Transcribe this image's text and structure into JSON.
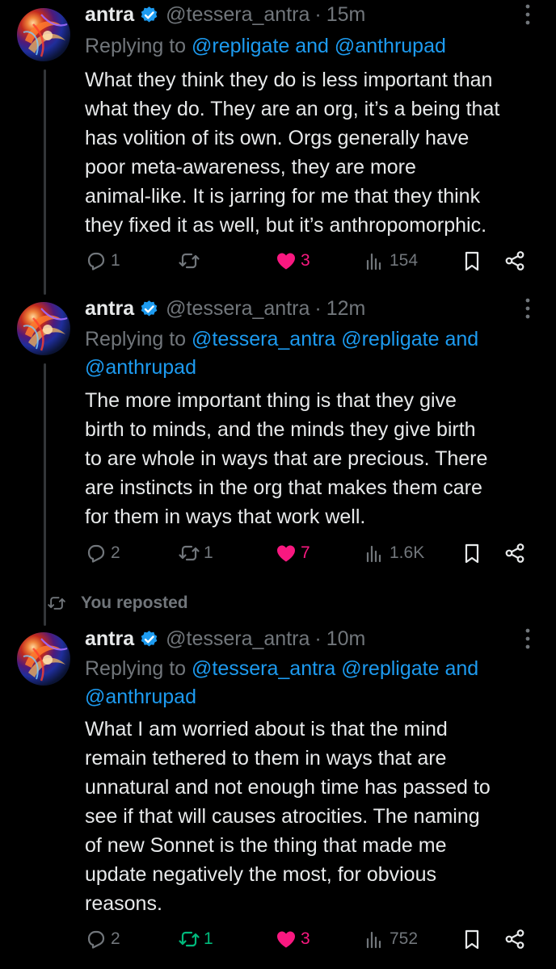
{
  "colors": {
    "background": "#000000",
    "text": "#e7e9ea",
    "muted": "#71767b",
    "link": "#1d9bf0",
    "like": "#f91880",
    "retweet_active": "#00ba7c"
  },
  "tweets": [
    {
      "name": "antra",
      "handle": "@tessera_antra",
      "separator": "·",
      "time": "15m",
      "replying_label": "Replying to",
      "replying_text": "@repligate and @anthrupad",
      "replying_continuation": "",
      "body_lines": [
        "What they think they do is less important than",
        "what they do. They are an org, it’s a being that",
        "has volition of its own. Orgs generally have",
        "poor meta-awareness, they are more",
        "animal-like. It is jarring for me that they think",
        "they fixed it as well, but it’s anthropomorphic."
      ],
      "replies": "1",
      "retweets": "",
      "likes": "3",
      "views": "154"
    },
    {
      "name": "antra",
      "handle": "@tessera_antra",
      "separator": "·",
      "time": "12m",
      "replying_label": "Replying to",
      "replying_text": "@tessera_antra @repligate and",
      "replying_continuation": "@anthrupad",
      "body_lines": [
        "The more important thing is that they give",
        "birth to minds, and the minds they give birth",
        "to are whole in ways that are precious. There",
        "are instincts in the org that makes them care",
        "for them in ways that work well."
      ],
      "replies": "2",
      "retweets": "1",
      "likes": "7",
      "views": "1.6K"
    },
    {
      "name": "antra",
      "handle": "@tessera_antra",
      "separator": "·",
      "time": "10m",
      "replying_label": "Replying to",
      "replying_text": "@tessera_antra @repligate and",
      "replying_continuation": "@anthrupad",
      "body_lines": [
        "What I am worried about is that the mind",
        "remain tethered to them in ways that are",
        "unnatural and not enough time has passed to",
        "see if that will causes atrocities. The naming",
        "of new Sonnet is the thing that made me",
        "update negatively the most, for obvious",
        "reasons."
      ],
      "replies": "2",
      "retweets": "1",
      "likes": "3",
      "views": "752"
    }
  ],
  "reposted_label": "You reposted",
  "icons": [
    "verified-badge-icon",
    "more-options-icon",
    "reply-icon",
    "retweet-icon",
    "like-icon",
    "views-icon",
    "bookmark-icon",
    "share-icon"
  ]
}
